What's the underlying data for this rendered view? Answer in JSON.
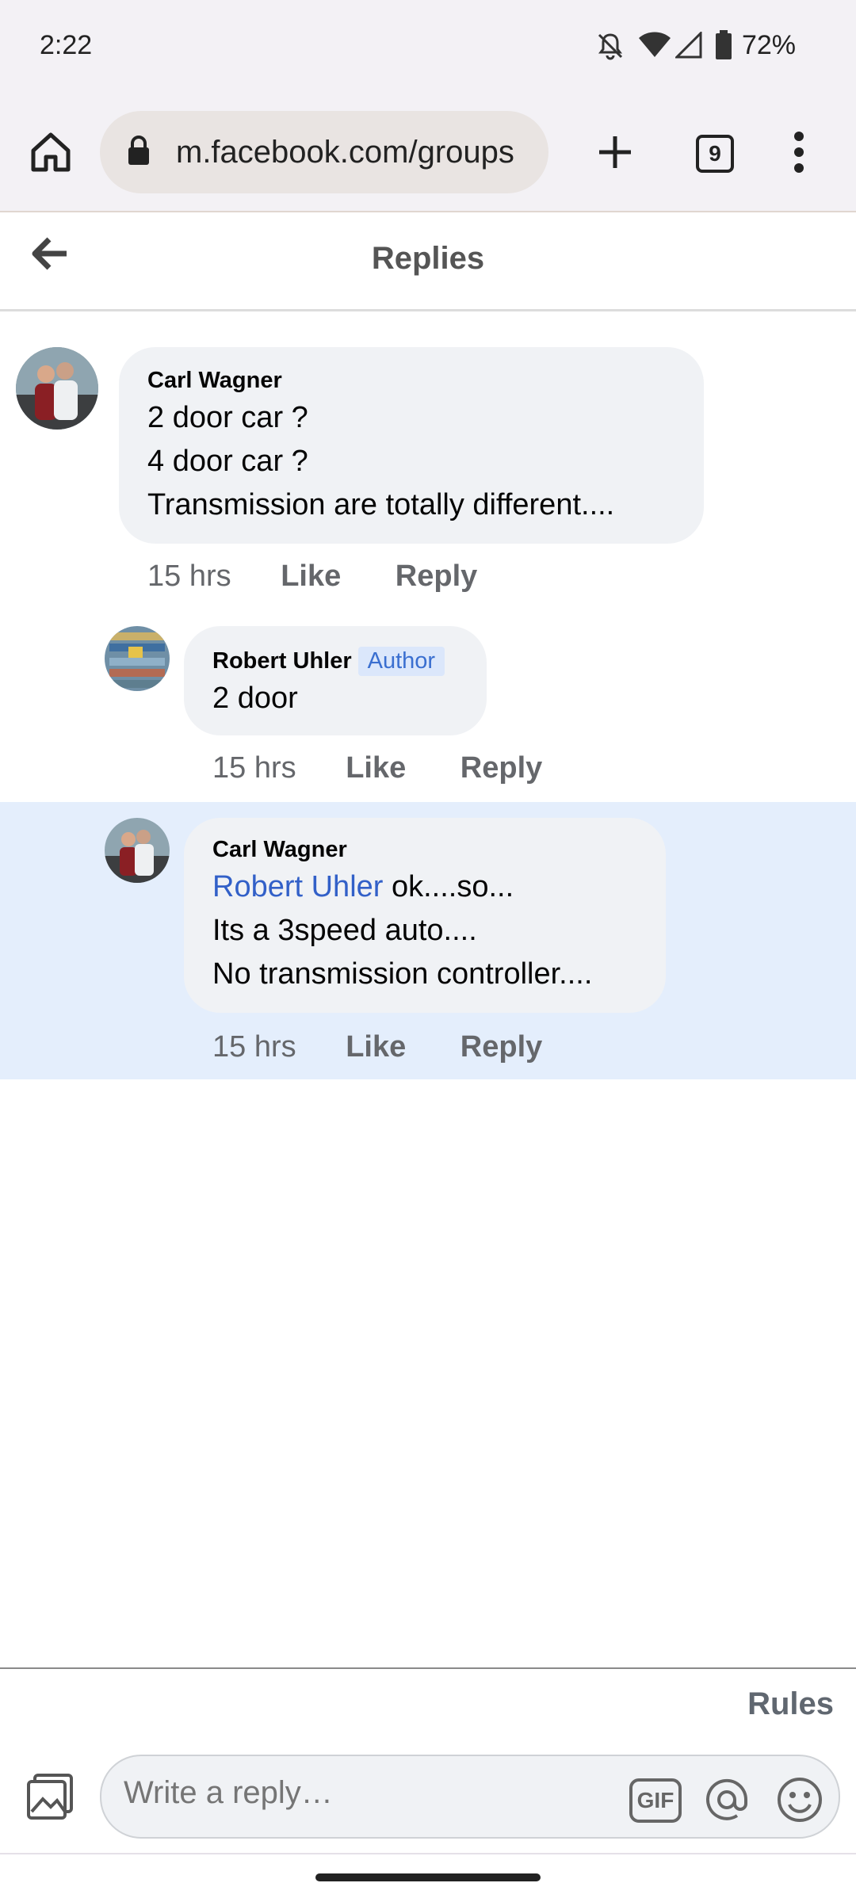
{
  "status_bar": {
    "time": "2:22",
    "battery": "72%",
    "icons": [
      "bell-off-icon",
      "wifi-icon",
      "signal-icon",
      "battery-icon"
    ]
  },
  "browser": {
    "url": "m.facebook.com/groups",
    "tab_count": "9",
    "icons": [
      "home-icon",
      "lock-icon",
      "new-tab-icon",
      "tabs-icon",
      "more-icon"
    ]
  },
  "header": {
    "title": "Replies",
    "back_icon": "back-arrow-icon"
  },
  "comments": [
    {
      "author": "Carl Wagner",
      "lines": [
        "2 door car ?",
        "4 door car ?",
        "Transmission are totally different...."
      ],
      "time": "15 hrs",
      "like": "Like",
      "reply": "Reply"
    },
    {
      "author": "Robert Uhler",
      "badge": "Author",
      "lines": [
        "2 door"
      ],
      "time": "15 hrs",
      "like": "Like",
      "reply": "Reply"
    },
    {
      "author": "Carl Wagner",
      "mention": "Robert Uhler",
      "first_line_rest": " ok....so...",
      "lines": [
        "Its a 3speed auto....",
        "No transmission controller...."
      ],
      "time": "15 hrs",
      "like": "Like",
      "reply": "Reply"
    }
  ],
  "footer": {
    "rules": "Rules",
    "placeholder": "Write a reply…",
    "gif_label": "GIF",
    "icons": [
      "photo-icon",
      "gif-icon",
      "mention-icon",
      "emoji-icon"
    ]
  },
  "colors": {
    "highlight": "#e4eefc",
    "bubble": "#f0f2f5",
    "mention": "#3260c8",
    "badge_bg": "#dbe7fb"
  }
}
